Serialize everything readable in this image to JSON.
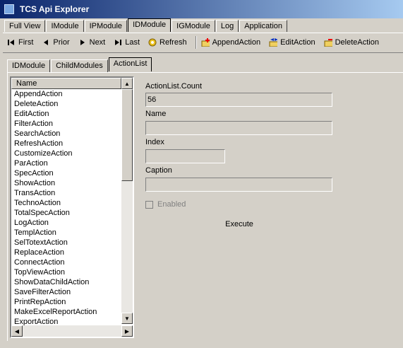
{
  "window": {
    "title": "TCS Api Explorer"
  },
  "top_tabs": [
    {
      "label": "Full View",
      "active": false
    },
    {
      "label": "IModule",
      "active": false
    },
    {
      "label": "IPModule",
      "active": false
    },
    {
      "label": "IDModule",
      "active": true
    },
    {
      "label": "IGModule",
      "active": false
    },
    {
      "label": "Log",
      "active": false
    },
    {
      "label": "Application",
      "active": false
    }
  ],
  "toolbar": {
    "first": "First",
    "prior": "Prior",
    "next": "Next",
    "last": "Last",
    "refresh": "Refresh",
    "append": "AppendAction",
    "edit": "EditAction",
    "delete": "DeleteAction"
  },
  "sub_tabs": [
    {
      "label": "IDModule",
      "active": false
    },
    {
      "label": "ChildModules",
      "active": false
    },
    {
      "label": "ActionList",
      "active": true
    }
  ],
  "list": {
    "header": "Name",
    "items": [
      "AppendAction",
      "DeleteAction",
      "EditAction",
      "FilterAction",
      "SearchAction",
      "RefreshAction",
      "CustomizeAction",
      "ParAction",
      "SpecAction",
      "ShowAction",
      "TransAction",
      "TechnoAction",
      "TotalSpecAction",
      "LogAction",
      "TemplAction",
      "SelTotextAction",
      "ReplaceAction",
      "ConnectAction",
      "TopViewAction",
      "ShowDataChildAction",
      "SaveFilterAction",
      "PrintRepAction",
      "MakeExcelReportAction",
      "ExportAction"
    ]
  },
  "form": {
    "count_label": "ActionList.Count",
    "count_value": "56",
    "name_label": "Name",
    "name_value": "",
    "index_label": "Index",
    "index_value": "",
    "caption_label": "Caption",
    "caption_value": "",
    "enabled_label": "Enabled",
    "enabled_checked": false,
    "execute_label": "Execute"
  },
  "colors": {
    "title_start": "#0a246a",
    "title_end": "#a6caf0",
    "face": "#d4d0c8"
  }
}
